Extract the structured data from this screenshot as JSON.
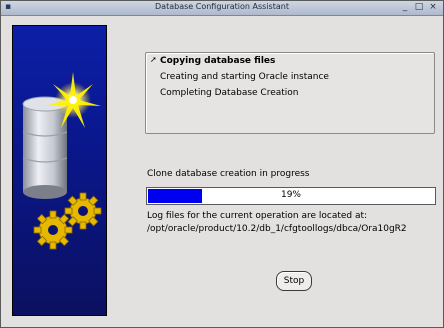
{
  "window": {
    "title": "Database Configuration Assistant"
  },
  "steps": [
    {
      "label": "Copying database files",
      "current": true
    },
    {
      "label": "Creating and starting Oracle instance",
      "current": false
    },
    {
      "label": "Completing Database Creation",
      "current": false
    }
  ],
  "progress": {
    "status": "Clone database creation in progress",
    "percent": 19,
    "percent_label": "19%"
  },
  "log": {
    "line1": "Log files for the current operation are located at:",
    "line2": "/opt/oracle/product/10.2/db_1/cfgtoollogs/dbca/Ora10gR2"
  },
  "buttons": {
    "stop": "Stop"
  },
  "icons": {
    "art": "database-cylinder-sparkle-gears",
    "step_arrow": "pointer-arrow-icon"
  },
  "colors": {
    "progress_fill": "#0000f0",
    "art_background": "#0c1fa6"
  }
}
